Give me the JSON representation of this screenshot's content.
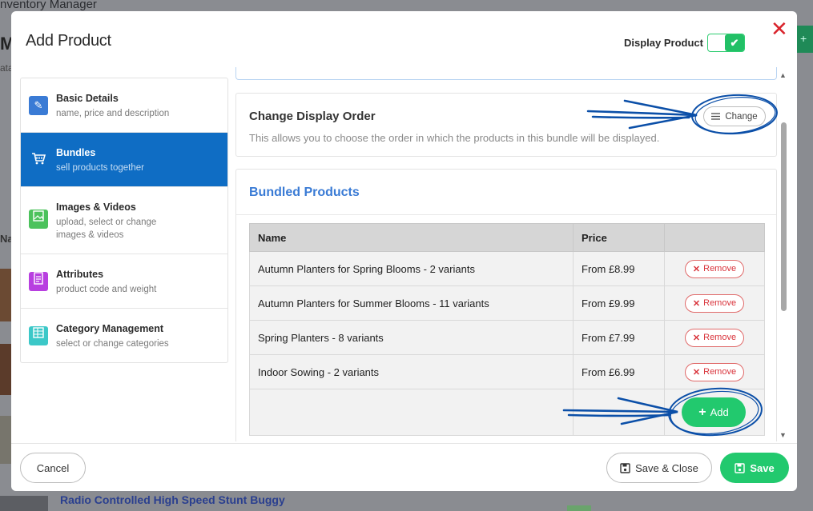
{
  "background": {
    "app_title": "nventory Manager",
    "big_letter": "M",
    "sub_text": "ata",
    "na_text": "Na",
    "product_link": "Radio Controlled High Speed Stunt Buggy"
  },
  "modal": {
    "title": "Add Product",
    "display_label": "Display Product",
    "display_enabled": true,
    "close_symbol": "✕"
  },
  "nav": {
    "items": [
      {
        "label": "Basic Details",
        "sub": "name, price and description",
        "icon": "pencil-icon",
        "color": "#3a7bd5"
      },
      {
        "label": "Bundles",
        "sub": "sell products together",
        "icon": "cart-icon",
        "color": "#0f6dc4",
        "active": true
      },
      {
        "label": "Images & Videos",
        "sub": "upload, select or change images & videos",
        "icon": "image-icon",
        "color": "#4cc25c"
      },
      {
        "label": "Attributes",
        "sub": "product code and weight",
        "icon": "file-icon",
        "color": "#b83fe0"
      },
      {
        "label": "Category Management",
        "sub": "select or change categories",
        "icon": "table-icon",
        "color": "#3cc8c8"
      }
    ]
  },
  "order": {
    "title": "Change Display Order",
    "description": "This allows you to choose the order in which the products in this bundle will be displayed.",
    "change_label": "Change"
  },
  "bundled": {
    "title": "Bundled Products",
    "headers": {
      "name": "Name",
      "price": "Price"
    },
    "rows": [
      {
        "name": "Autumn Planters for Spring Blooms - 2 variants",
        "price": "From £8.99"
      },
      {
        "name": "Autumn Planters for Summer Blooms - 11 variants",
        "price": "From £9.99"
      },
      {
        "name": "Spring Planters - 8 variants",
        "price": "From £7.99"
      },
      {
        "name": "Indoor Sowing - 2 variants",
        "price": "From £6.99"
      }
    ],
    "remove_label": "Remove",
    "add_label": "Add"
  },
  "footer": {
    "cancel_label": "Cancel",
    "save_close_label": "Save & Close",
    "save_label": "Save"
  },
  "colors": {
    "accent": "#0f6dc4",
    "success": "#22c96e",
    "danger": "#d9343c",
    "annotation": "#0b4fa8"
  }
}
